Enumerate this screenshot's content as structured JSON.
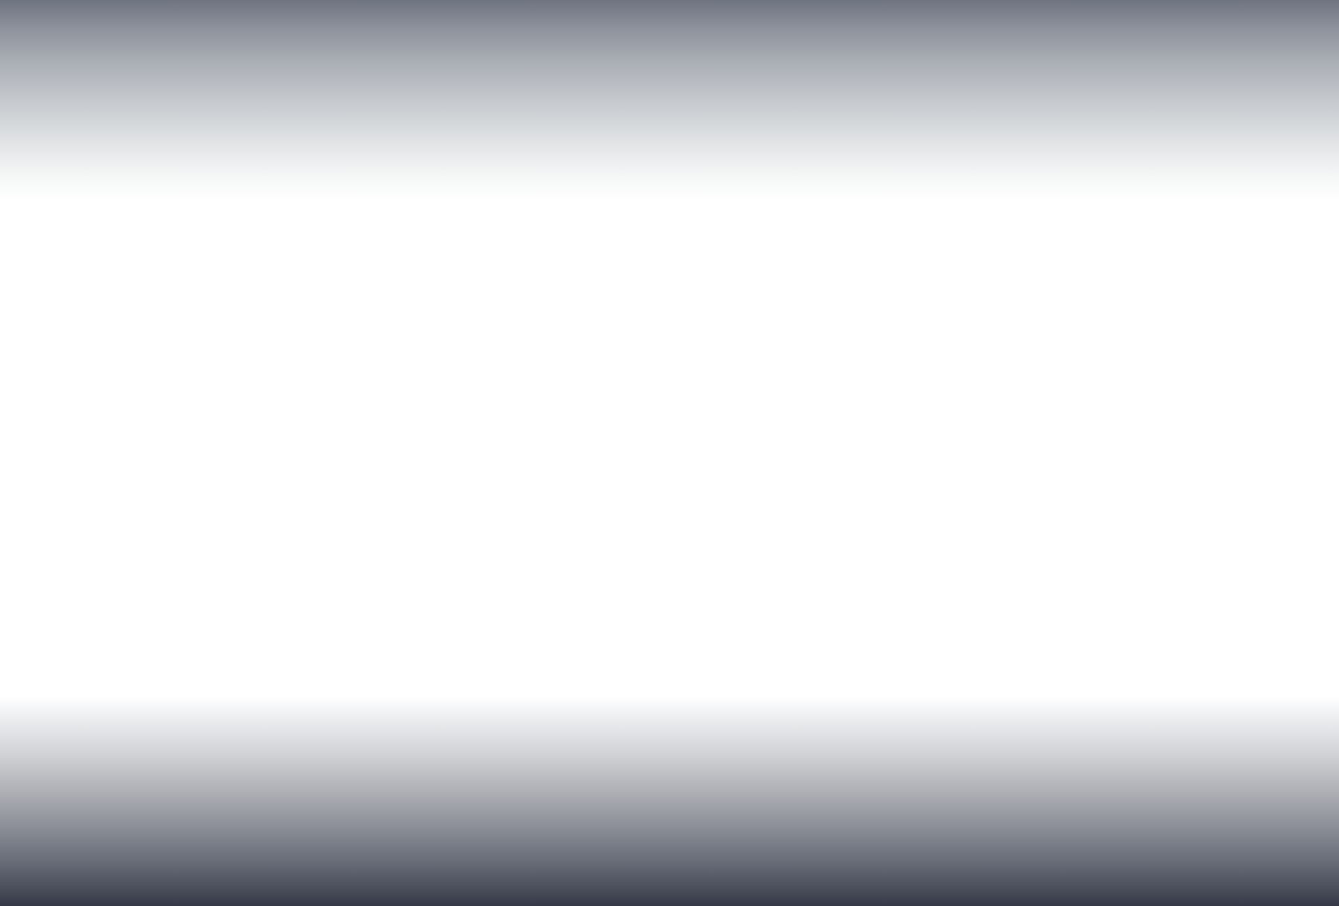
{
  "screen": {
    "colors": {
      "top_gradient_start": "#6e7480",
      "top_gradient_end": "#ffffff",
      "content_background": "#ffffff",
      "bottom_gradient_start": "#ffffff",
      "bottom_gradient_end": "#353947"
    }
  }
}
